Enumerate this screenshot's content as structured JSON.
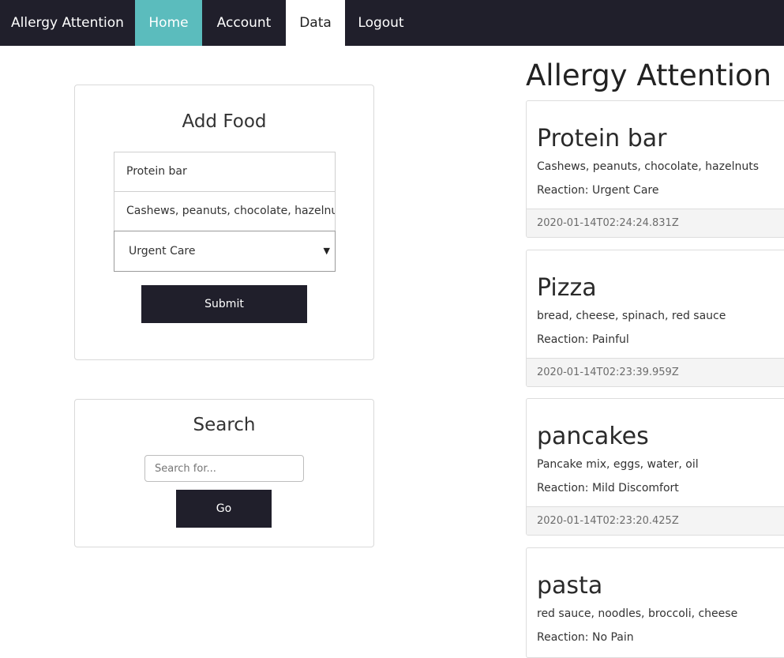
{
  "nav": {
    "brand": "Allergy Attention",
    "home": "Home",
    "account": "Account",
    "data": "Data",
    "logout": "Logout"
  },
  "add_food": {
    "title": "Add Food",
    "food_name_value": "Protein bar",
    "ingredients_value": "Cashews, peanuts, chocolate, hazelnuts",
    "reaction_selected": "Urgent Care",
    "submit_label": "Submit"
  },
  "search": {
    "title": "Search",
    "placeholder": "Search for...",
    "go_label": "Go"
  },
  "main": {
    "heading": "Allergy Attention"
  },
  "entries": [
    {
      "name": "Protein bar",
      "ingredients": "Cashews, peanuts, chocolate, hazelnuts",
      "reaction": "Reaction: Urgent Care",
      "timestamp": "2020-01-14T02:24:24.831Z"
    },
    {
      "name": "Pizza",
      "ingredients": "bread, cheese, spinach, red sauce",
      "reaction": "Reaction: Painful",
      "timestamp": "2020-01-14T02:23:39.959Z"
    },
    {
      "name": "pancakes",
      "ingredients": "Pancake mix, eggs, water, oil",
      "reaction": "Reaction: Mild Discomfort",
      "timestamp": "2020-01-14T02:23:20.425Z"
    },
    {
      "name": "pasta",
      "ingredients": "red sauce, noodles, broccoli, cheese",
      "reaction": "Reaction: No Pain",
      "timestamp": ""
    }
  ],
  "colors": {
    "navbar_bg": "#201f2b",
    "home_active_bg": "#5bbcbd",
    "button_bg": "#201f2b"
  }
}
